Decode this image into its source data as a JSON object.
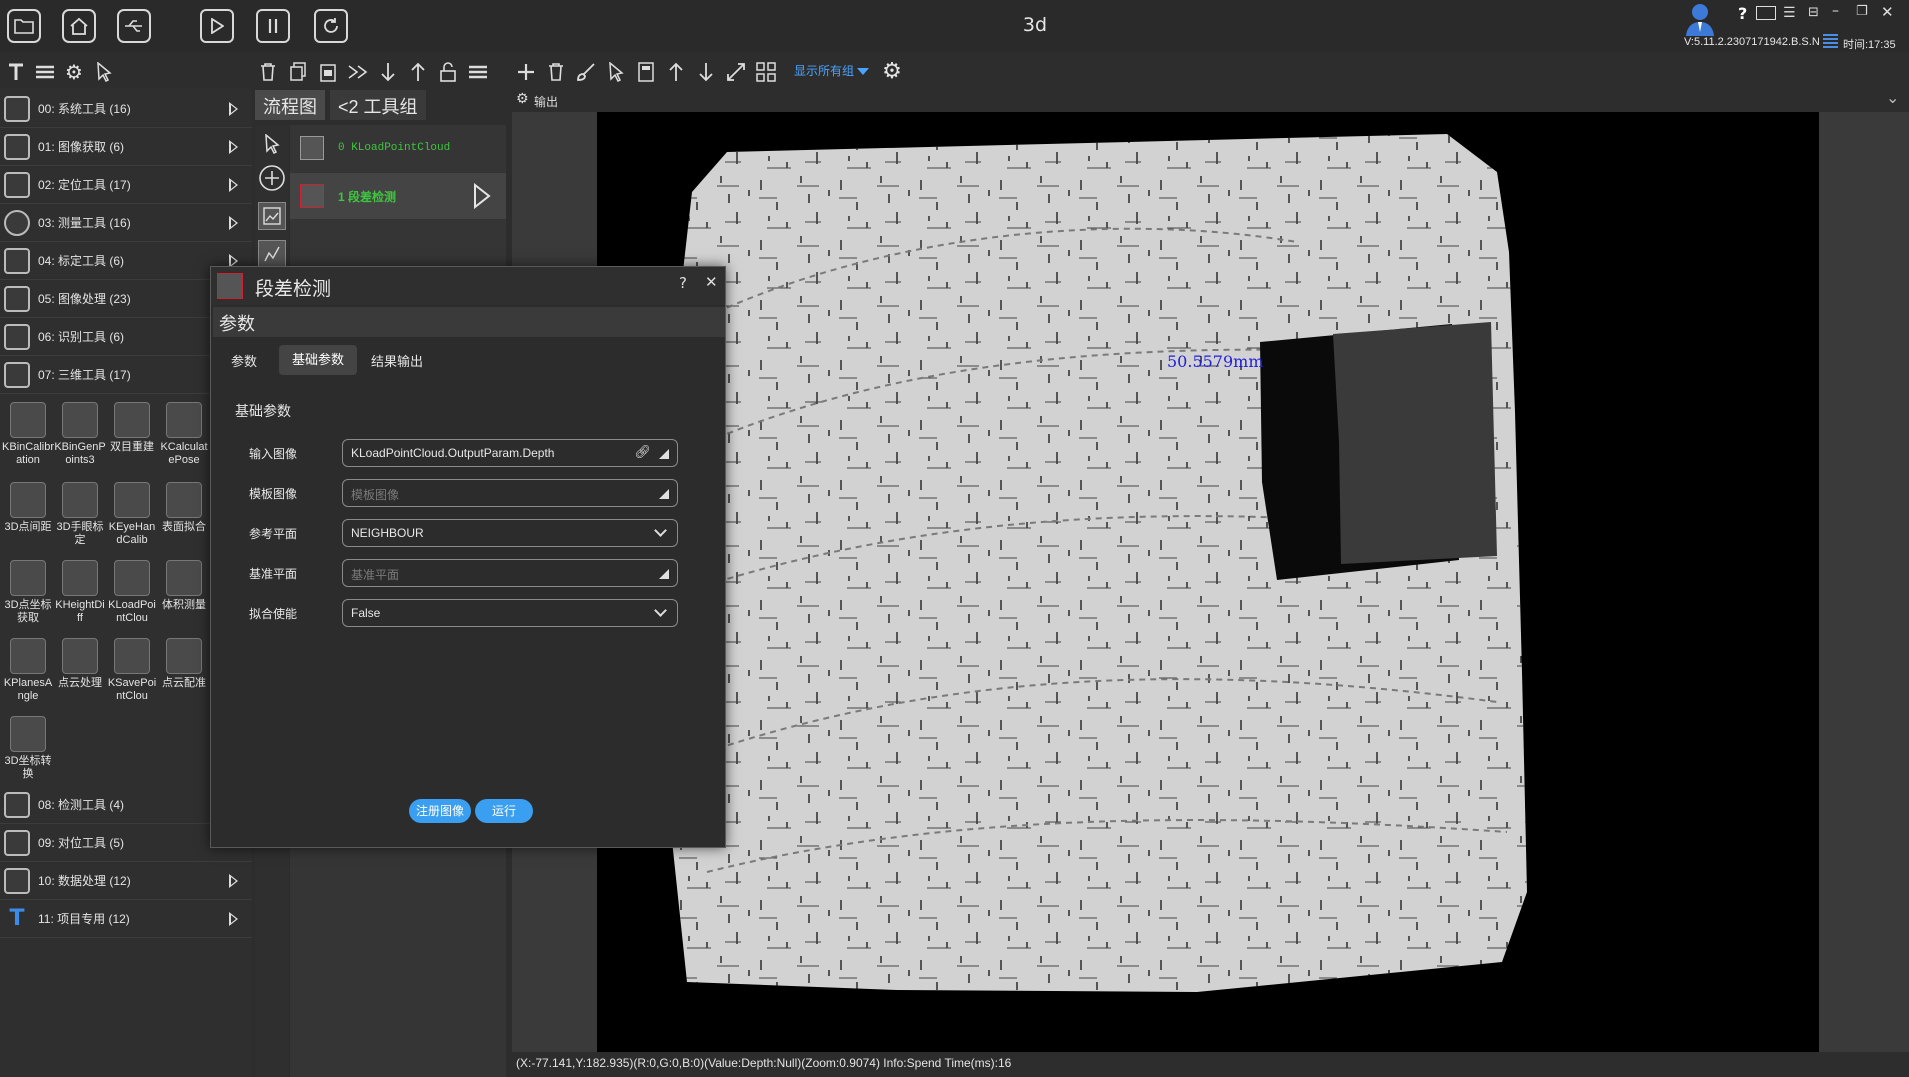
{
  "window": {
    "title": "3d",
    "version": "V:5.11.2.2307171942.B.S.N",
    "time": "时间:17:35",
    "help": "?"
  },
  "toolbar_right": {
    "show_groups": "显示所有组"
  },
  "categories": [
    {
      "label": "00: 系统工具 (16)"
    },
    {
      "label": "01: 图像获取 (6)"
    },
    {
      "label": "02: 定位工具 (17)"
    },
    {
      "label": "03: 测量工具 (16)"
    },
    {
      "label": "04: 标定工具 (6)"
    },
    {
      "label": "05: 图像处理 (23)"
    },
    {
      "label": "06: 识别工具 (6)"
    },
    {
      "label": "07: 三维工具 (17)"
    },
    {
      "label": "08: 检测工具 (4)"
    },
    {
      "label": "09: 对位工具 (5)"
    },
    {
      "label": "10: 数据处理 (12)"
    },
    {
      "label": "11: 项目专用 (12)"
    }
  ],
  "tools3d": [
    {
      "label": "KBinCalibration"
    },
    {
      "label": "KBinGenPoints3"
    },
    {
      "label": "双目重建"
    },
    {
      "label": "KCalculatePose"
    },
    {
      "label": "3D点间距"
    },
    {
      "label": "3D手眼标定"
    },
    {
      "label": "KEyeHandCalib"
    },
    {
      "label": "表面拟合"
    },
    {
      "label": "3D点坐标获取"
    },
    {
      "label": "KHeightDiff"
    },
    {
      "label": "KLoadPointClou"
    },
    {
      "label": "体积测量"
    },
    {
      "label": "KPlanesAngle"
    },
    {
      "label": "点云处理"
    },
    {
      "label": "KSavePointClou"
    },
    {
      "label": "点云配准"
    },
    {
      "label": "3D坐标转换"
    }
  ],
  "flow": {
    "tab_flow": "流程图",
    "tab_group": "<2 工具组",
    "nodes": [
      {
        "label": "0 KLoadPointCloud"
      },
      {
        "label": "1 段差检测"
      }
    ]
  },
  "output": {
    "title": "输出",
    "measurement": "50.5579mm",
    "status": "(X:-77.141,Y:182.935)(R:0,G:0,B:0)(Value:Depth:Null)(Zoom:0.9074)   Info:Spend Time(ms):16"
  },
  "dialog": {
    "title": "段差检测",
    "section": "参数",
    "tabs": [
      "参数",
      "基础参数",
      "结果输出"
    ],
    "heading": "基础参数",
    "fields": [
      {
        "label": "输入图像",
        "value": "KLoadPointCloud.OutputParam.Depth",
        "placeholder": ""
      },
      {
        "label": "模板图像",
        "value": "",
        "placeholder": "模板图像"
      },
      {
        "label": "参考平面",
        "value": "NEIGHBOUR",
        "placeholder": ""
      },
      {
        "label": "基准平面",
        "value": "",
        "placeholder": "基准平面"
      },
      {
        "label": "拟合使能",
        "value": "False",
        "placeholder": ""
      }
    ],
    "btn_register": "注册图像",
    "btn_run": "运行"
  }
}
